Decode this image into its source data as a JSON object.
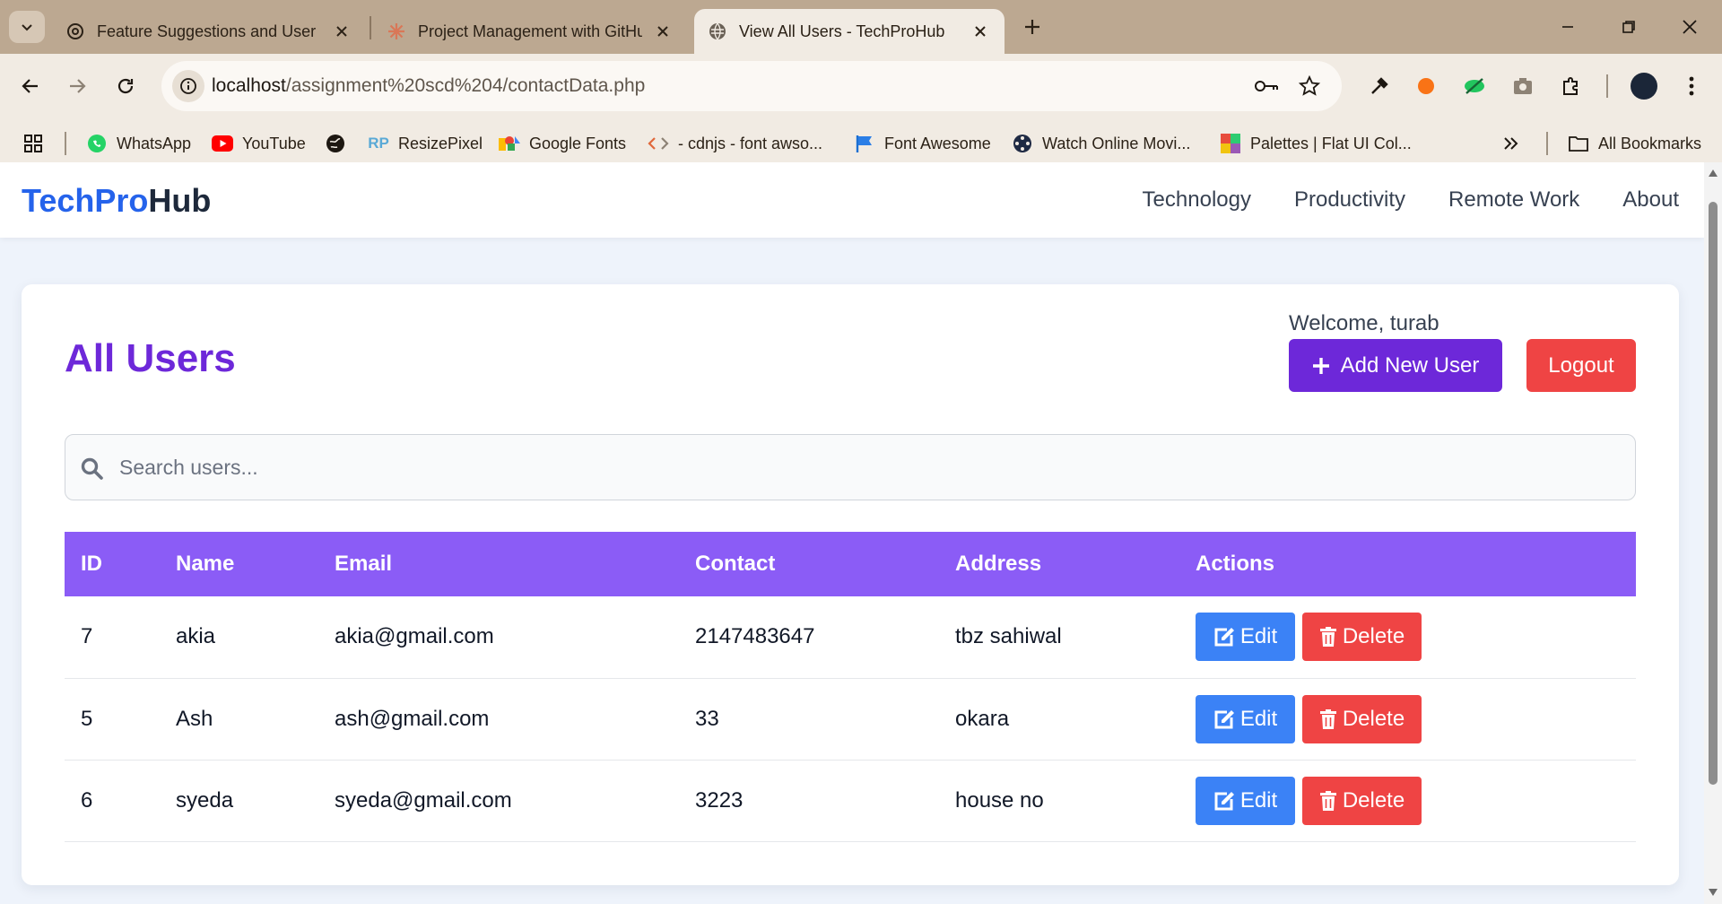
{
  "browser": {
    "tabs": [
      {
        "title": "Feature Suggestions and User S",
        "favicon": "openai-icon",
        "active": false
      },
      {
        "title": "Project Management with GitHu",
        "favicon": "claude-icon",
        "active": false
      },
      {
        "title": "View All Users - TechProHub",
        "favicon": "globe-icon",
        "active": true
      }
    ],
    "url_host": "localhost",
    "url_path": "/assignment%20scd%204/contactData.php",
    "bookmarks": [
      {
        "label": "WhatsApp",
        "icon": "whatsapp-icon"
      },
      {
        "label": "YouTube",
        "icon": "youtube-icon"
      },
      {
        "label": "",
        "icon": "globe-icon"
      },
      {
        "label": "ResizePixel",
        "icon": "resizepixel-icon"
      },
      {
        "label": "Google Fonts",
        "icon": "google-fonts-icon"
      },
      {
        "label": "- cdnjs - font awso...",
        "icon": "code-icon"
      },
      {
        "label": "Font Awesome",
        "icon": "flag-icon"
      },
      {
        "label": "Watch Online Movi...",
        "icon": "film-reel-icon"
      },
      {
        "label": "Palettes | Flat UI Col...",
        "icon": "palette-icon"
      }
    ],
    "all_bookmarks_label": "All Bookmarks"
  },
  "site": {
    "logo_part1": "TechPro",
    "logo_part2": "Hub",
    "nav": [
      "Technology",
      "Productivity",
      "Remote Work",
      "About"
    ]
  },
  "page": {
    "title": "All Users",
    "welcome": "Welcome, turab",
    "add_button": "Add New User",
    "logout_button": "Logout",
    "search_placeholder": "Search users...",
    "columns": [
      "ID",
      "Name",
      "Email",
      "Contact",
      "Address",
      "Actions"
    ],
    "rows": [
      {
        "id": "7",
        "name": "akia",
        "email": "akia@gmail.com",
        "contact": "2147483647",
        "address": "tbz sahiwal"
      },
      {
        "id": "5",
        "name": "Ash",
        "email": "ash@gmail.com",
        "contact": "33",
        "address": "okara"
      },
      {
        "id": "6",
        "name": "syeda",
        "email": "syeda@gmail.com",
        "contact": "3223",
        "address": "house no"
      }
    ],
    "edit_label": "Edit",
    "delete_label": "Delete"
  },
  "colors": {
    "primary": "#6d28d9",
    "table_header": "#8b5cf6",
    "edit": "#3b82f6",
    "danger": "#ef4444",
    "logo_blue": "#2563eb"
  }
}
